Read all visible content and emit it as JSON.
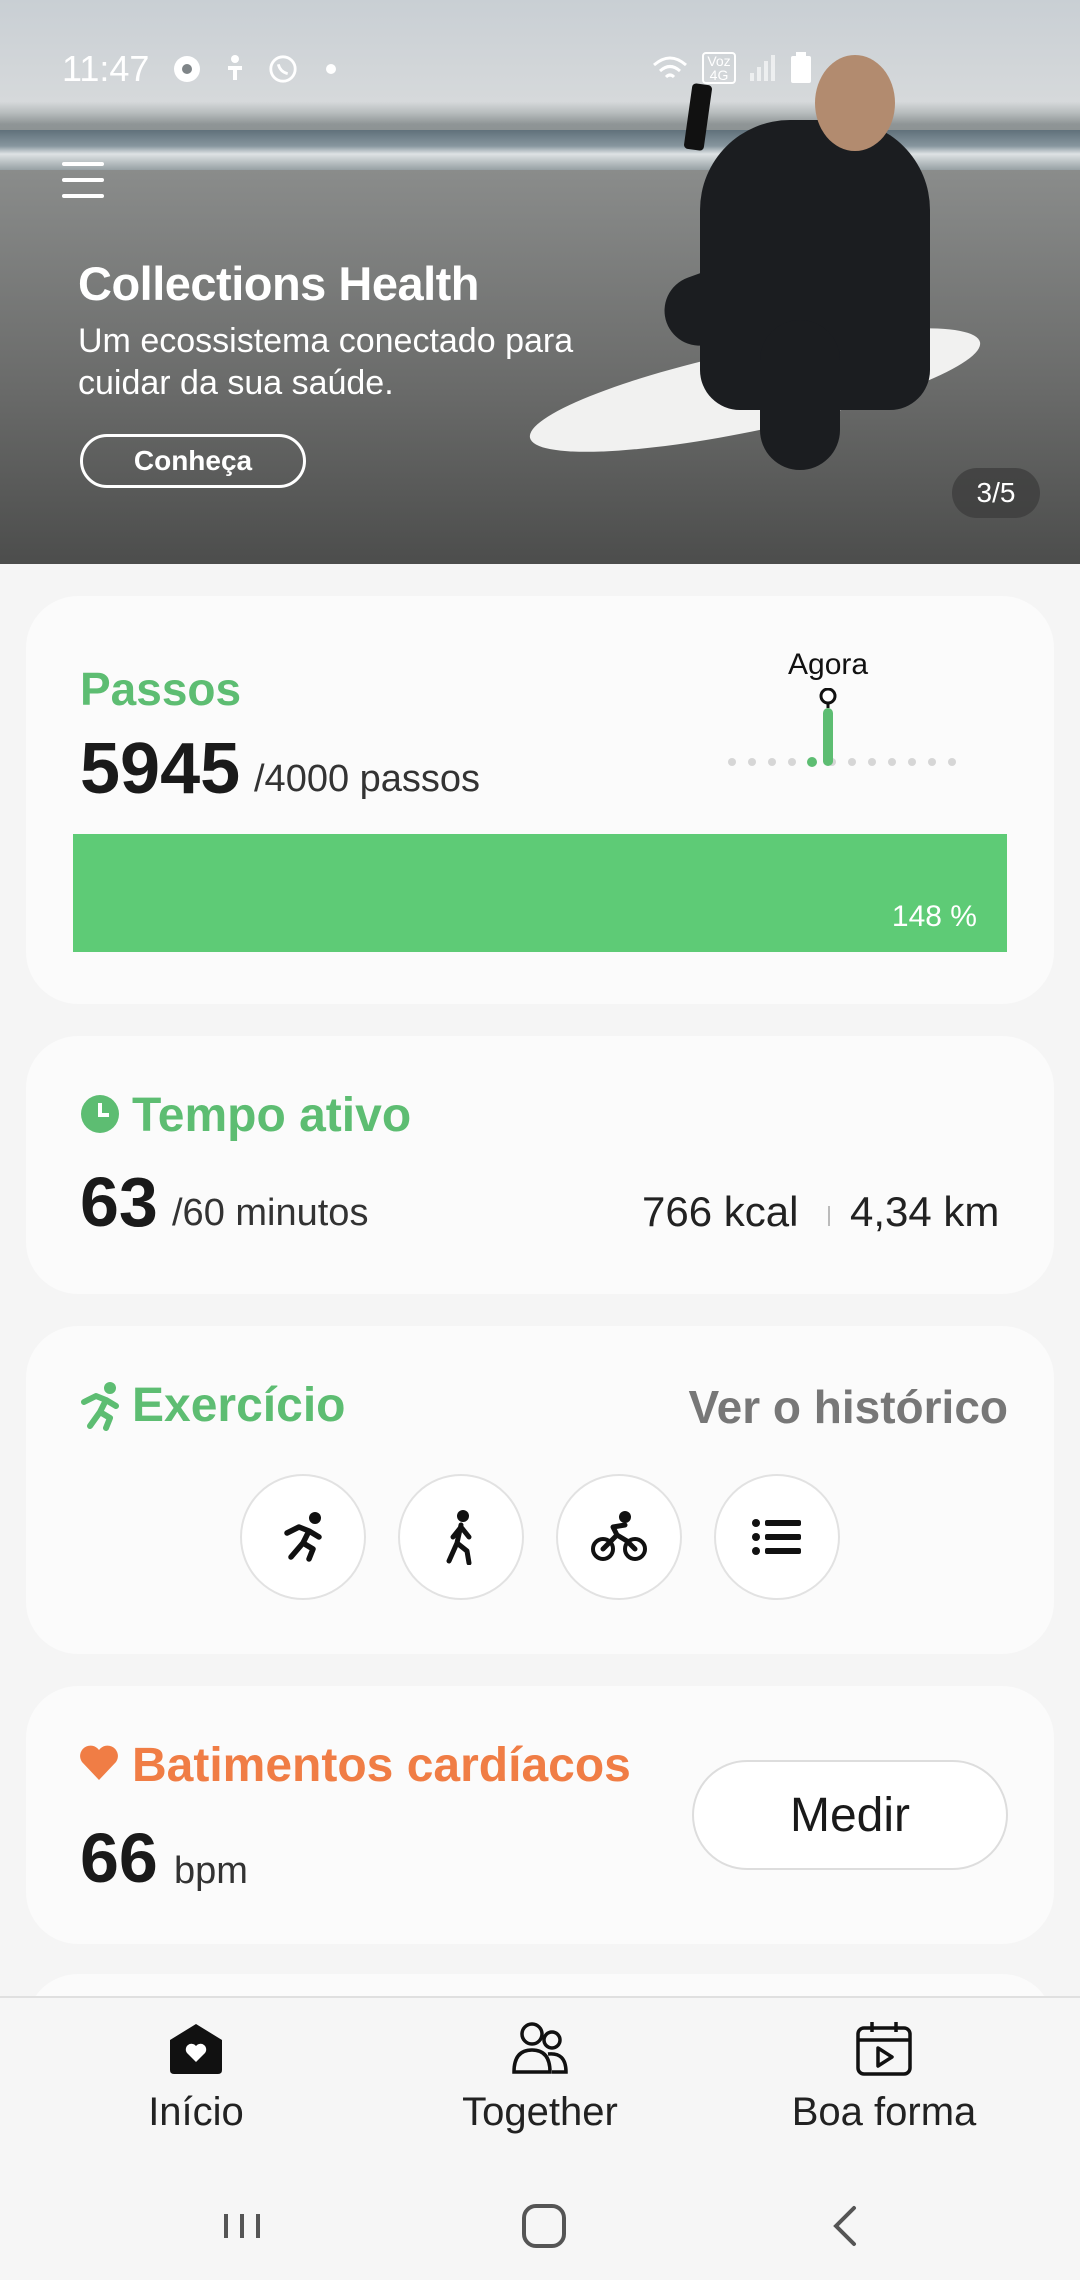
{
  "status_bar": {
    "time": "11:47",
    "network_badge": "Voz 4G"
  },
  "banner": {
    "title": "Collections Health",
    "subtitle": "Um ecossistema conectado para cuidar da sua saúde.",
    "cta_label": "Conheça",
    "pager": "3/5"
  },
  "steps": {
    "label": "Passos",
    "value": "5945",
    "goal": "/4000 passos",
    "now_label": "Agora",
    "progress_text": "148 %",
    "progress_fraction": 1.0
  },
  "active_time": {
    "label": "Tempo ativo",
    "value": "63",
    "goal": "/60 minutos",
    "kcal": "766 kcal",
    "distance": "4,34 km"
  },
  "exercise": {
    "label": "Exercício",
    "history_link": "Ver o histórico",
    "buttons": [
      "run-icon",
      "walk-icon",
      "bike-icon",
      "list-icon"
    ]
  },
  "heart_rate": {
    "label": "Batimentos cardíacos",
    "value": "66",
    "unit": "bpm",
    "measure_label": "Medir"
  },
  "bottom_nav": {
    "home": "Início",
    "together": "Together",
    "fitness": "Boa forma"
  },
  "colors": {
    "accent_green": "#5dbd72",
    "bar_green": "#5ecb76",
    "accent_orange": "#f07d45"
  }
}
